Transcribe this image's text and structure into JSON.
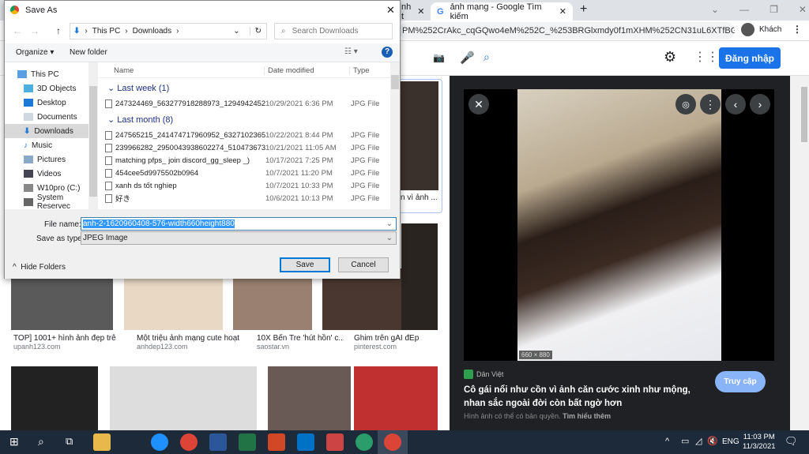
{
  "browser": {
    "tab_partial": "nh t",
    "tab_title": "ảnh mạng - Google Tìm kiếm",
    "url": "PM%252CrAkc_cqGQwo4eM%252C_%253BRGlxmdy0f1mXHM%252CN31uL6XTfBGBkM...",
    "profile": "Khách",
    "login": "Đăng nhập"
  },
  "results": [
    {
      "caption": "TOP] 1001+ hình ảnh đẹp trên ...",
      "source": "upanh123.com"
    },
    {
      "caption": "Một triệu ảnh mạng cute hoạt...",
      "source": "anhdep123.com"
    },
    {
      "caption": "10X Bến Tre 'hút hồn' c...",
      "source": "saostar.vn"
    },
    {
      "caption": "Ghim trên gÁI đEp",
      "source": "pinterest.com"
    }
  ],
  "partial_caption": "n vì ảnh ...",
  "preview": {
    "dimensions": "660 × 880",
    "site": "Dân Việt",
    "title": "Cô gái nổi như cồn vì ảnh căn cước xinh như mộng, nhan sắc ngoài đời còn bất ngờ hơn",
    "visit": "Truy cập",
    "copyright": "Hình ảnh có thể có bản quyền.",
    "learn_more": "Tìm hiểu thêm"
  },
  "dialog": {
    "title": "Save As",
    "path": [
      "This PC",
      "Downloads"
    ],
    "search_placeholder": "Search Downloads",
    "organize": "Organize ▾",
    "new_folder": "New folder",
    "tree": [
      "This PC",
      "3D Objects",
      "Desktop",
      "Documents",
      "Downloads",
      "Music",
      "Pictures",
      "Videos",
      "W10pro (C:)",
      "System Reservec"
    ],
    "columns": {
      "name": "Name",
      "date": "Date modified",
      "type": "Type"
    },
    "groups": [
      {
        "label": "Last week (1)",
        "files": [
          {
            "name": "247324469_563277918288973_1294942452...",
            "date": "10/29/2021 6:36 PM",
            "type": "JPG File"
          }
        ]
      },
      {
        "label": "Last month (8)",
        "files": [
          {
            "name": "247565215_241474717960952_6327102365...",
            "date": "10/22/2021 8:44 PM",
            "type": "JPG File"
          },
          {
            "name": "239966282_2950043938602274_510473673...",
            "date": "10/21/2021 11:05 AM",
            "type": "JPG File"
          },
          {
            "name": "matching pfps_ join discord_gg_sleep _)",
            "date": "10/17/2021 7:25 PM",
            "type": "JPG File"
          },
          {
            "name": "454cee5d9975502b0964",
            "date": "10/7/2021 11:20 PM",
            "type": "JPG File"
          },
          {
            "name": "xanh ds tốt nghiep",
            "date": "10/7/2021 10:33 PM",
            "type": "JPG File"
          },
          {
            "name": "好き",
            "date": "10/6/2021 10:13 PM",
            "type": "JPG File"
          }
        ]
      }
    ],
    "file_name_label": "File name:",
    "file_name": "anh-2-1620960408-576-width660height880",
    "type_label": "Save as type:",
    "type_value": "JPEG Image",
    "hide_folders": "Hide Folders",
    "save": "Save",
    "cancel": "Cancel"
  },
  "taskbar": {
    "lang": "ENG",
    "time": "11:03 PM",
    "date": "11/3/2021"
  },
  "colors": {
    "accent": "#1a73e8",
    "panel": "#202124",
    "selection": "#3399ff"
  }
}
